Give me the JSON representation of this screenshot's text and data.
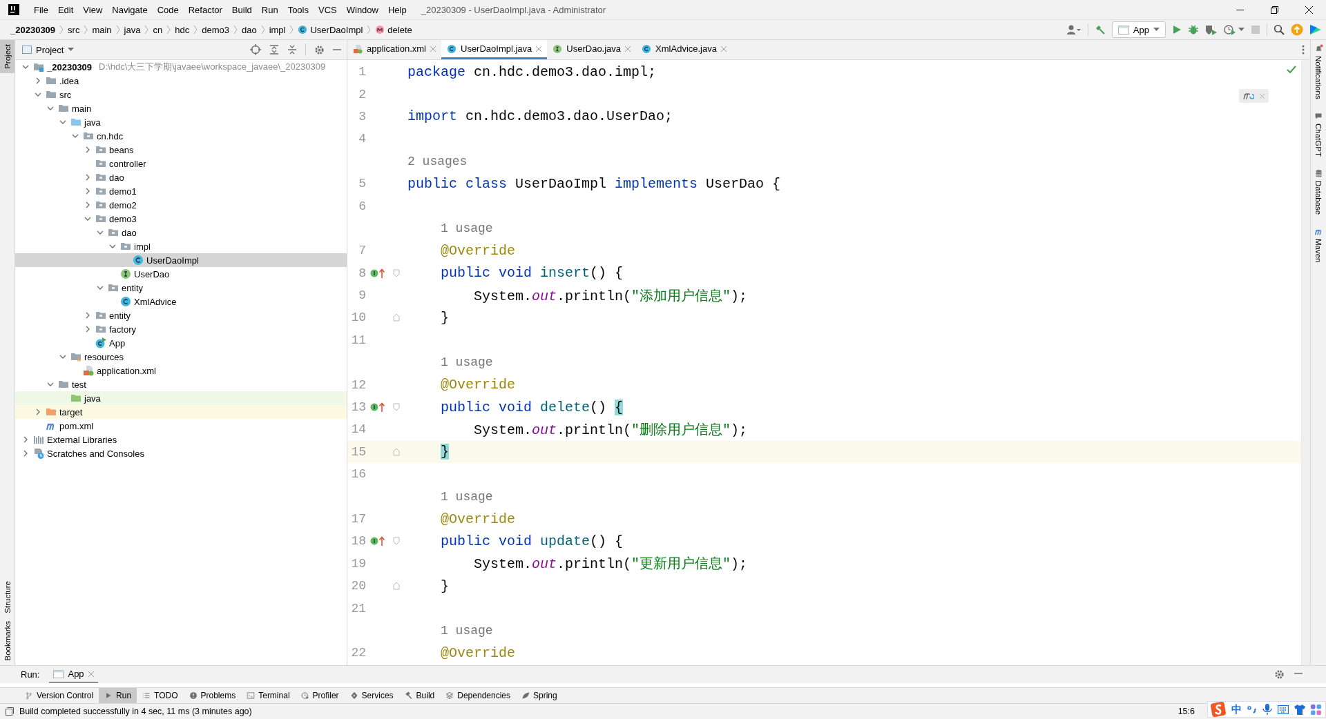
{
  "menu": [
    "File",
    "Edit",
    "View",
    "Navigate",
    "Code",
    "Refactor",
    "Build",
    "Run",
    "Tools",
    "VCS",
    "Window",
    "Help"
  ],
  "window_title": "_20230309 - UserDaoImpl.java - Administrator",
  "breadcrumbs": [
    {
      "label": "_20230309",
      "kind": "segment"
    },
    {
      "label": "src",
      "kind": "segment"
    },
    {
      "label": "main",
      "kind": "segment"
    },
    {
      "label": "java",
      "kind": "segment"
    },
    {
      "label": "cn",
      "kind": "segment"
    },
    {
      "label": "hdc",
      "kind": "segment"
    },
    {
      "label": "demo3",
      "kind": "segment"
    },
    {
      "label": "dao",
      "kind": "segment"
    },
    {
      "label": "impl",
      "kind": "segment"
    },
    {
      "label": "UserDaoImpl",
      "kind": "class"
    },
    {
      "label": "delete",
      "kind": "method"
    }
  ],
  "run_config": "App",
  "left_stripe": {
    "top": [
      {
        "label": "Project",
        "selected": true
      }
    ],
    "bottom": [
      {
        "label": "Structure",
        "selected": false
      },
      {
        "label": "Bookmarks",
        "selected": false
      }
    ]
  },
  "right_stripe": [
    {
      "label": "Notifications",
      "kind": "bell"
    },
    {
      "label": "ChatGPT",
      "kind": "chat"
    },
    {
      "label": "Database",
      "kind": "database"
    },
    {
      "label": "Maven",
      "kind": "maven"
    }
  ],
  "project_panel": {
    "title": "Project",
    "tree": [
      {
        "label": "_20230309",
        "path": "D:\\hdc\\大三下学期\\javaee\\workspace_javaee\\_20230309",
        "kind": "module",
        "expanded": true,
        "selected": false,
        "children": [
          {
            "label": ".idea",
            "kind": "folder",
            "expanded": false,
            "selected": false
          },
          {
            "label": "src",
            "kind": "folder",
            "expanded": true,
            "selected": false,
            "children": [
              {
                "label": "main",
                "kind": "folder",
                "expanded": true,
                "selected": false,
                "children": [
                  {
                    "label": "java",
                    "kind": "folder_source",
                    "expanded": true,
                    "selected": false,
                    "children": [
                      {
                        "label": "cn.hdc",
                        "kind": "package",
                        "expanded": true,
                        "selected": false,
                        "children": [
                          {
                            "label": "beans",
                            "kind": "package",
                            "expanded": false,
                            "selected": false
                          },
                          {
                            "label": "controller",
                            "kind": "package",
                            "selected": false
                          },
                          {
                            "label": "dao",
                            "kind": "package",
                            "expanded": false,
                            "selected": false
                          },
                          {
                            "label": "demo1",
                            "kind": "package",
                            "expanded": false,
                            "selected": false
                          },
                          {
                            "label": "demo2",
                            "kind": "package",
                            "expanded": false,
                            "selected": false
                          },
                          {
                            "label": "demo3",
                            "kind": "package",
                            "expanded": true,
                            "selected": false,
                            "children": [
                              {
                                "label": "dao",
                                "kind": "package",
                                "expanded": true,
                                "selected": false,
                                "children": [
                                  {
                                    "label": "impl",
                                    "kind": "package",
                                    "expanded": true,
                                    "selected": false,
                                    "children": [
                                      {
                                        "label": "UserDaoImpl",
                                        "kind": "class",
                                        "selected": true
                                      }
                                    ]
                                  },
                                  {
                                    "label": "UserDao",
                                    "kind": "interface",
                                    "selected": false
                                  }
                                ]
                              },
                              {
                                "label": "entity",
                                "kind": "package",
                                "expanded": true,
                                "selected": false,
                                "children": [
                                  {
                                    "label": "XmlAdvice",
                                    "kind": "class",
                                    "selected": false
                                  }
                                ]
                              }
                            ]
                          },
                          {
                            "label": "entity",
                            "kind": "package",
                            "expanded": false,
                            "selected": false
                          },
                          {
                            "label": "factory",
                            "kind": "package",
                            "expanded": false,
                            "selected": false
                          },
                          {
                            "label": "App",
                            "kind": "class_main",
                            "selected": false
                          }
                        ]
                      }
                    ]
                  },
                  {
                    "label": "resources",
                    "kind": "folder_resources",
                    "expanded": true,
                    "selected": false,
                    "children": [
                      {
                        "label": "application.xml",
                        "kind": "xml",
                        "selected": false
                      }
                    ]
                  }
                ]
              },
              {
                "label": "test",
                "kind": "folder",
                "expanded": true,
                "selected": false,
                "children": [
                  {
                    "label": "java",
                    "kind": "folder_test",
                    "selected": false
                  }
                ]
              }
            ]
          },
          {
            "label": "target",
            "kind": "folder_excluded",
            "expanded": false,
            "selected": false
          },
          {
            "label": "pom.xml",
            "kind": "maven",
            "selected": false
          }
        ]
      },
      {
        "label": "External Libraries",
        "kind": "libraries",
        "expanded": false,
        "selected": false
      },
      {
        "label": "Scratches and Consoles",
        "kind": "scratches",
        "expanded": false,
        "selected": false
      }
    ]
  },
  "editor": {
    "tabs": [
      {
        "label": "application.xml",
        "kind": "xml",
        "selected": false
      },
      {
        "label": "UserDaoImpl.java",
        "kind": "class",
        "selected": true
      },
      {
        "label": "UserDao.java",
        "kind": "interface",
        "selected": false
      },
      {
        "label": "XmlAdvice.java",
        "kind": "class",
        "selected": false
      }
    ],
    "lines": [
      {
        "kind": "line",
        "number": "1",
        "current": false,
        "tokens": [
          {
            "kind": "kw",
            "s": "package"
          },
          {
            "kind": "plain",
            "s": " cn.hdc.demo3.dao.impl;"
          }
        ]
      },
      {
        "kind": "line",
        "number": "2",
        "current": false
      },
      {
        "kind": "line",
        "number": "3",
        "current": false,
        "tokens": [
          {
            "kind": "kw",
            "s": "import"
          },
          {
            "kind": "plain",
            "s": " cn.hdc.demo3.dao.UserDao;"
          }
        ]
      },
      {
        "kind": "line",
        "number": "4",
        "current": false
      },
      {
        "kind": "hint",
        "text": "2 usages"
      },
      {
        "kind": "line",
        "number": "5",
        "current": false,
        "tokens": [
          {
            "kind": "kw",
            "s": "public class"
          },
          {
            "kind": "plain",
            "s": " UserDaoImpl "
          },
          {
            "kind": "kw",
            "s": "implements"
          },
          {
            "kind": "plain",
            "s": " UserDao {"
          }
        ],
        "children": [
          {
            "kind": "line",
            "number": "6",
            "current": false
          },
          {
            "kind": "hint",
            "text": "1 usage"
          },
          {
            "kind": "line",
            "number": "7",
            "current": false,
            "tokens": [
              {
                "kind": "anno",
                "s": "@Override"
              }
            ]
          },
          {
            "kind": "method",
            "number": "8",
            "current": false,
            "tokens": [
              {
                "kind": "kw",
                "s": "public void "
              },
              {
                "kind": "method",
                "s": "insert"
              },
              {
                "kind": "plain",
                "s": "() {"
              }
            ],
            "children": [
              {
                "kind": "line",
                "number": "9",
                "current": false,
                "tokens": [
                  {
                    "kind": "plain",
                    "s": "System."
                  },
                  {
                    "kind": "field",
                    "s": "out"
                  },
                  {
                    "kind": "plain",
                    "s": ".println("
                  },
                  {
                    "kind": "str",
                    "s": "\"添加用户信息\""
                  },
                  {
                    "kind": "plain",
                    "s": ");"
                  }
                ]
              }
            ]
          },
          {
            "kind": "block_end",
            "number": "10",
            "current": false,
            "tokens": [
              {
                "kind": "plain",
                "s": "}"
              }
            ]
          },
          {
            "kind": "line",
            "number": "11",
            "current": false
          },
          {
            "kind": "hint",
            "text": "1 usage"
          },
          {
            "kind": "line",
            "number": "12",
            "current": false,
            "tokens": [
              {
                "kind": "anno",
                "s": "@Override"
              }
            ]
          },
          {
            "kind": "method",
            "number": "13",
            "current": false,
            "tokens": [
              {
                "kind": "kw",
                "s": "public void "
              },
              {
                "kind": "method",
                "s": "delete"
              },
              {
                "kind": "plain",
                "s": "() "
              },
              {
                "kind": "brace",
                "s": "{"
              }
            ],
            "children": [
              {
                "kind": "line",
                "number": "14",
                "current": false,
                "tokens": [
                  {
                    "kind": "plain",
                    "s": "System."
                  },
                  {
                    "kind": "field",
                    "s": "out"
                  },
                  {
                    "kind": "plain",
                    "s": ".println("
                  },
                  {
                    "kind": "str",
                    "s": "\"删除用户信息\""
                  },
                  {
                    "kind": "plain",
                    "s": ");"
                  }
                ]
              }
            ]
          },
          {
            "kind": "block_end",
            "number": "15",
            "current": true,
            "tokens": [
              {
                "kind": "brace",
                "s": "}"
              }
            ]
          },
          {
            "kind": "line",
            "number": "16",
            "current": false
          },
          {
            "kind": "hint",
            "text": "1 usage"
          },
          {
            "kind": "line",
            "number": "17",
            "current": false,
            "tokens": [
              {
                "kind": "anno",
                "s": "@Override"
              }
            ]
          },
          {
            "kind": "method",
            "number": "18",
            "current": false,
            "tokens": [
              {
                "kind": "kw",
                "s": "public void "
              },
              {
                "kind": "method",
                "s": "update"
              },
              {
                "kind": "plain",
                "s": "() {"
              }
            ],
            "children": [
              {
                "kind": "line",
                "number": "19",
                "current": false,
                "tokens": [
                  {
                    "kind": "plain",
                    "s": "System."
                  },
                  {
                    "kind": "field",
                    "s": "out"
                  },
                  {
                    "kind": "plain",
                    "s": ".println("
                  },
                  {
                    "kind": "str",
                    "s": "\"更新用户信息\""
                  },
                  {
                    "kind": "plain",
                    "s": ");"
                  }
                ]
              }
            ]
          },
          {
            "kind": "block_end",
            "number": "20",
            "current": false,
            "tokens": [
              {
                "kind": "plain",
                "s": "}"
              }
            ]
          },
          {
            "kind": "line",
            "number": "21",
            "current": false
          },
          {
            "kind": "hint",
            "text": "1 usage"
          },
          {
            "kind": "line",
            "number": "22",
            "current": false,
            "tokens": [
              {
                "kind": "anno",
                "s": "@Override"
              }
            ]
          }
        ]
      }
    ]
  },
  "run_panel": {
    "label": "Run:",
    "tabs": [
      {
        "label": "App",
        "selected": true
      }
    ]
  },
  "tool_windows": [
    {
      "label": "Version Control",
      "kind": "vcs",
      "selected": false
    },
    {
      "label": "Run",
      "kind": "run",
      "selected": true
    },
    {
      "label": "TODO",
      "kind": "list",
      "selected": false
    },
    {
      "label": "Problems",
      "kind": "problems",
      "selected": false
    },
    {
      "label": "Terminal",
      "kind": "terminal",
      "selected": false
    },
    {
      "label": "Profiler",
      "kind": "profiler",
      "selected": false
    },
    {
      "label": "Services",
      "kind": "services",
      "selected": false
    },
    {
      "label": "Build",
      "kind": "hammer",
      "selected": false
    },
    {
      "label": "Dependencies",
      "kind": "layers",
      "selected": false
    },
    {
      "label": "Spring",
      "kind": "leaf",
      "selected": false
    }
  ],
  "status": {
    "message": "Build completed successfully in 4 sec, 11 ms (3 minutes ago)",
    "position": "15:6",
    "ime_mode": "中"
  }
}
